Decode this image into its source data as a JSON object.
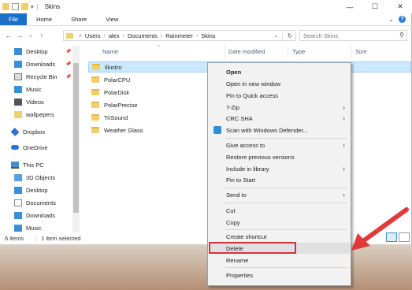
{
  "window": {
    "title": "Skins"
  },
  "ribbon": {
    "tabs": [
      "File",
      "Home",
      "Share",
      "View"
    ]
  },
  "addressbar": {
    "crumbs": [
      "Users",
      "alex",
      "Documents",
      "Rainmeter",
      "Skins"
    ],
    "search_placeholder": "Search Skins"
  },
  "navpane": {
    "items": [
      {
        "label": "Desktop",
        "icon": "desktop-icon",
        "pinned": true
      },
      {
        "label": "Downloads",
        "icon": "downloads-icon",
        "pinned": true
      },
      {
        "label": "Recycle Bin",
        "icon": "recycle-bin-icon",
        "pinned": true
      },
      {
        "label": "Music",
        "icon": "music-icon"
      },
      {
        "label": "Videos",
        "icon": "videos-icon"
      },
      {
        "label": "wallpepers",
        "icon": "folder-icon"
      },
      {
        "label": "Dropbox",
        "icon": "dropbox-icon"
      },
      {
        "label": "OneDrive",
        "icon": "onedrive-icon"
      },
      {
        "label": "This PC",
        "icon": "this-pc-icon"
      },
      {
        "label": "3D Objects",
        "icon": "3d-objects-icon"
      },
      {
        "label": "Desktop",
        "icon": "desktop-icon"
      },
      {
        "label": "Documents",
        "icon": "documents-icon"
      },
      {
        "label": "Downloads",
        "icon": "downloads-icon"
      },
      {
        "label": "Music",
        "icon": "music-icon"
      }
    ]
  },
  "content": {
    "columns": [
      "Name",
      "Date modified",
      "Type",
      "Size"
    ],
    "files": [
      "illustro",
      "PolarCPU",
      "PolarDisk",
      "PolarPrecise",
      "TriSound",
      "Weather Glass"
    ]
  },
  "status": {
    "items_count": "6 items",
    "selected": "1 item selected"
  },
  "context_menu": {
    "items": [
      {
        "label": "Open",
        "bold": true
      },
      {
        "label": "Open in new window"
      },
      {
        "label": "Pin to Quick access"
      },
      {
        "label": "7-Zip",
        "submenu": true
      },
      {
        "label": "CRC SHA",
        "submenu": true
      },
      {
        "label": "Scan with Windows Defender...",
        "icon": "windows-defender-icon"
      },
      {
        "label": "Give access to",
        "submenu": true
      },
      {
        "label": "Restore previous versions"
      },
      {
        "label": "Include in library",
        "submenu": true
      },
      {
        "label": "Pin to Start"
      },
      {
        "label": "Send to",
        "submenu": true
      },
      {
        "label": "Cut"
      },
      {
        "label": "Copy"
      },
      {
        "label": "Create shortcut"
      },
      {
        "label": "Delete",
        "highlighted": true
      },
      {
        "label": "Rename"
      },
      {
        "label": "Properties"
      }
    ]
  },
  "colors": {
    "file_tab": "#1a6fc7",
    "selection": "#cce8ff",
    "highlight_box": "#d0343a",
    "arrow": "#e03a3a"
  }
}
